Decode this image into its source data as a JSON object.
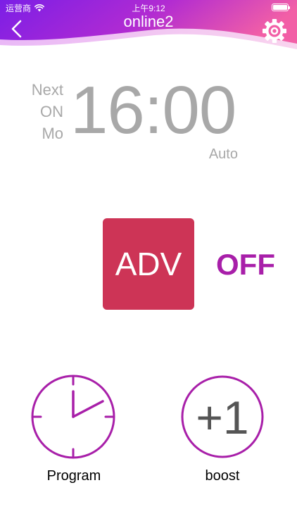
{
  "status_bar": {
    "carrier": "运营商",
    "time": "上午9:12",
    "battery_level": 1.0
  },
  "header": {
    "title": "online2",
    "back_icon": "chevron-left-icon",
    "settings_icon": "gear-icon"
  },
  "schedule": {
    "next_lines": [
      "Next",
      "ON",
      "Mo"
    ],
    "time": "16:00",
    "mode": "Auto"
  },
  "adv": {
    "label": "ADV",
    "state": "OFF"
  },
  "actions": {
    "program_label": "Program",
    "program_icon": "clock-icon",
    "boost_label": "boost",
    "boost_text": "+1"
  },
  "colors": {
    "header_gradient": [
      "#7b1ee6",
      "#c230c7",
      "#f25fa6"
    ],
    "adv_button": "#cd3456",
    "accent_purple": "#a81fa9",
    "text_gray": "#a8a8a8"
  }
}
